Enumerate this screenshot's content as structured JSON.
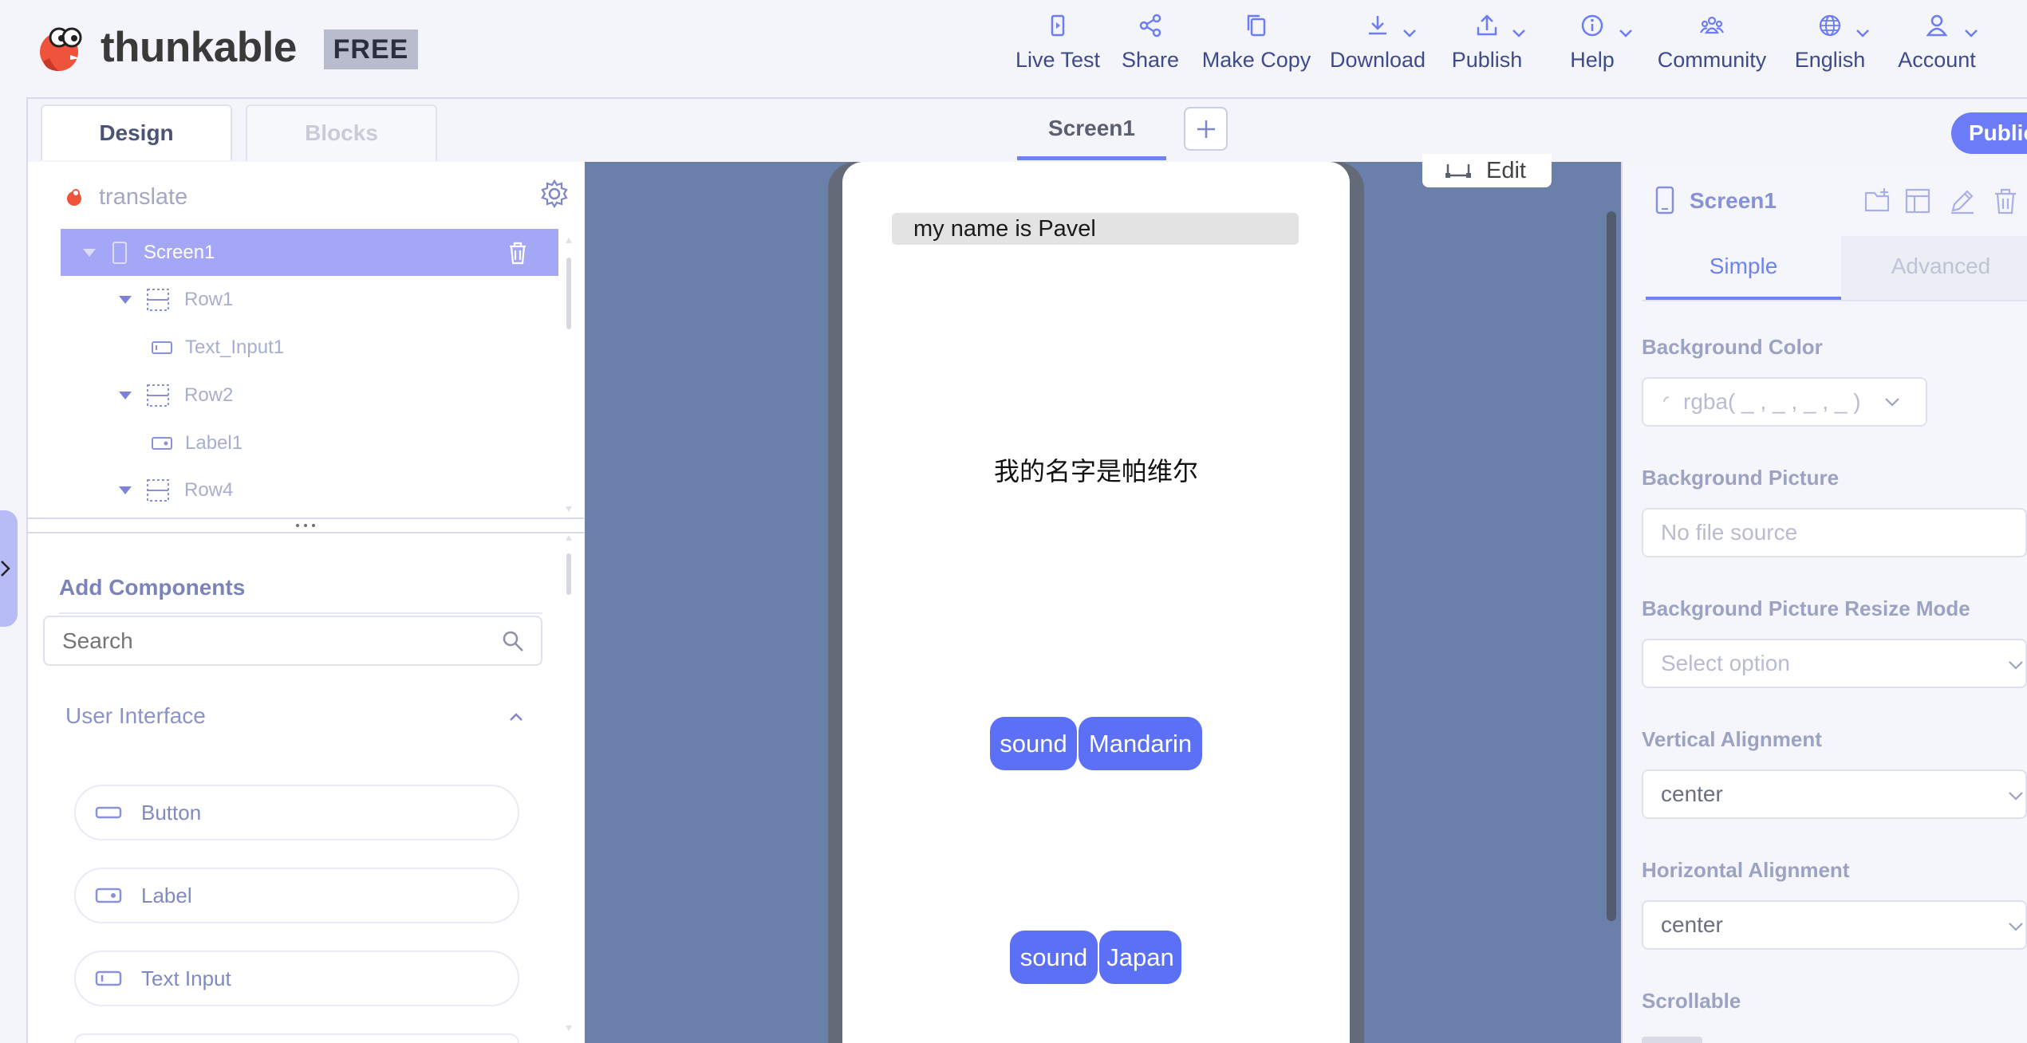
{
  "header": {
    "logo_text": "thunkable",
    "plan_badge": "FREE",
    "nav": [
      {
        "label": "Live Test",
        "icon": "live-test-icon"
      },
      {
        "label": "Share",
        "icon": "share-icon"
      },
      {
        "label": "Make Copy",
        "icon": "copy-icon"
      },
      {
        "label": "Download",
        "icon": "download-icon"
      },
      {
        "label": "Publish",
        "icon": "publish-icon"
      },
      {
        "label": "Help",
        "icon": "info-icon"
      },
      {
        "label": "Community",
        "icon": "community-icon"
      },
      {
        "label": "English",
        "icon": "globe-icon"
      },
      {
        "label": "Account",
        "icon": "user-icon"
      }
    ]
  },
  "tabs": {
    "design": "Design",
    "blocks": "Blocks",
    "screen": "Screen1",
    "publish_pill": "Public"
  },
  "tree": {
    "project_name": "translate",
    "items": [
      {
        "label": "Screen1",
        "type": "screen"
      },
      {
        "label": "Row1",
        "type": "row"
      },
      {
        "label": "Text_Input1",
        "type": "text-input"
      },
      {
        "label": "Row2",
        "type": "row"
      },
      {
        "label": "Label1",
        "type": "label"
      },
      {
        "label": "Row4",
        "type": "row"
      }
    ]
  },
  "components": {
    "title": "Add Components",
    "search_placeholder": "Search",
    "section": "User Interface",
    "items": [
      {
        "label": "Button",
        "icon": "button-icon"
      },
      {
        "label": "Label",
        "icon": "label-icon"
      },
      {
        "label": "Text Input",
        "icon": "text-input-icon"
      }
    ]
  },
  "canvas": {
    "edit_label": "Edit",
    "text_input_value": "my name is Pavel",
    "label_text": "我的名字是帕维尔",
    "row1_buttons": [
      "sound",
      "Mandarin"
    ],
    "row2_buttons": [
      "sound",
      "Japan"
    ]
  },
  "properties": {
    "component_name": "Screen1",
    "tab_simple": "Simple",
    "tab_advanced": "Advanced",
    "fields": [
      {
        "label": "Background Color",
        "value": "rgba( _ , _ , _ , _ )"
      },
      {
        "label": "Background Picture",
        "value": "No file source"
      },
      {
        "label": "Background Picture Resize Mode",
        "value": "Select option"
      },
      {
        "label": "Vertical Alignment",
        "value": "center"
      },
      {
        "label": "Horizontal Alignment",
        "value": "center"
      },
      {
        "label": "Scrollable",
        "value": ""
      }
    ]
  },
  "colors": {
    "accent": "#6b7cf6",
    "canvas": "#6b7fab",
    "selection": "#a4a6f6",
    "phone_button": "#5b70f4"
  }
}
